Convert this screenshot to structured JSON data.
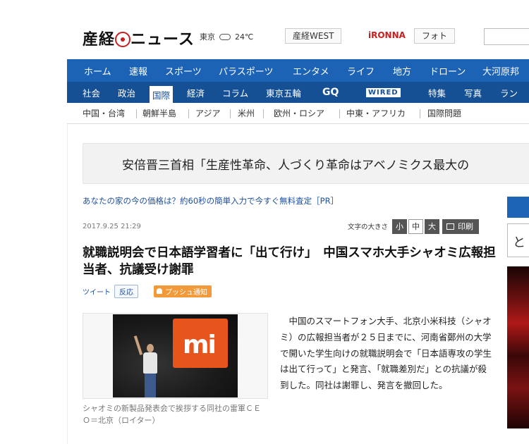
{
  "header": {
    "logo_text": "産経",
    "logo_text2": "ニュース",
    "weather_city": "東京",
    "weather_temp": "24℃",
    "links": [
      "産経WEST",
      "iRONNA",
      "フォト"
    ]
  },
  "nav_primary": [
    "ホーム",
    "速報",
    "スポーツ",
    "パラスポーツ",
    "エンタメ",
    "ライフ",
    "地方",
    "ドローン",
    "大河原邦"
  ],
  "nav_secondary": [
    "社会",
    "政治",
    "国際",
    "経済",
    "コラム",
    "東京五輪",
    "GQ",
    "WIRED",
    "特集",
    "写真",
    "ラン"
  ],
  "nav_secondary_active": "国際",
  "nav_sub": [
    "中国・台湾",
    "朝鮮半島",
    "アジア",
    "米州",
    "欧州・ロシア",
    "中東・アフリカ",
    "国際問題"
  ],
  "banner": {
    "text": "安倍晋三首相「生産性革命、人づくり革命はアベノミクス最大の"
  },
  "ad": {
    "text": "あなたの家の今の価格は？約60秒の簡単入力で今すぐ無料査定［PR］"
  },
  "article": {
    "date": "2017.9.25 21:29",
    "font_size_label": "文字の大きさ",
    "font_sizes": [
      "小",
      "中",
      "大"
    ],
    "font_size_selected": "中",
    "print_label": "印刷",
    "title": "就職説明会で日本語学習者に「出て行け」　中国スマホ大手シャオミ広報担当者、抗議受け謝罪",
    "tweet_label": "ツイート",
    "react_label": "反応",
    "push_label": "プッシュ通知",
    "photo_text": "mi",
    "caption": "シャオミの新製品発表会で挨拶する同社の雷軍ＣＥＯ＝北京（ロイター）",
    "body": "　中国のスマートフォン大手、北京小米科技（シャオミ）の広報担当者が２５日までに、河南省鄭州の大学で開いた学生向けの就職説明会で「日本語専攻の学生は出て行って」と発言、「就職差別だ」との抗議が殺到した。同社は謝罪し、発言を撤回した。"
  },
  "sidebar": {
    "fragment_text": "と"
  },
  "colors": {
    "nav_primary": "#1d63b5",
    "nav_secondary": "#154f94",
    "accent_red": "#c81e1e",
    "push_orange": "#f29a3a",
    "xiaomi_orange": "#e8551c"
  }
}
